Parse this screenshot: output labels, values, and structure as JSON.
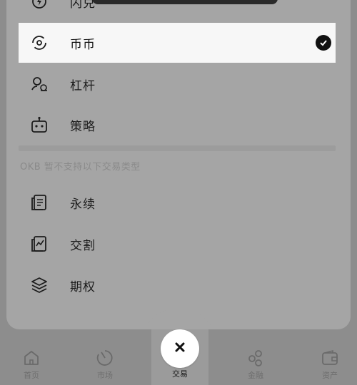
{
  "menu": {
    "items": [
      {
        "label": "闪兑",
        "icon": "flash-icon"
      },
      {
        "label": "币币",
        "icon": "spot-icon",
        "selected": true
      },
      {
        "label": "杠杆",
        "icon": "margin-icon"
      },
      {
        "label": "策略",
        "icon": "bot-icon"
      }
    ],
    "note": "OKB 暂不支持以下交易类型",
    "unsupported": [
      {
        "label": "永续",
        "icon": "perpetual-icon"
      },
      {
        "label": "交割",
        "icon": "futures-icon"
      },
      {
        "label": "期权",
        "icon": "options-icon"
      }
    ]
  },
  "tabbar": {
    "tabs": [
      {
        "label": "首页",
        "icon": "home-icon"
      },
      {
        "label": "市场",
        "icon": "market-icon"
      },
      {
        "label": "交易",
        "icon": "close-icon",
        "active": true
      },
      {
        "label": "金融",
        "icon": "finance-icon"
      },
      {
        "label": "资产",
        "icon": "wallet-icon"
      }
    ]
  },
  "colors": {
    "overlay": "#8d8d8d",
    "sheet": "#a5a5a5",
    "selected_row": "#f7f7f7",
    "text": "#1c1c1c"
  }
}
